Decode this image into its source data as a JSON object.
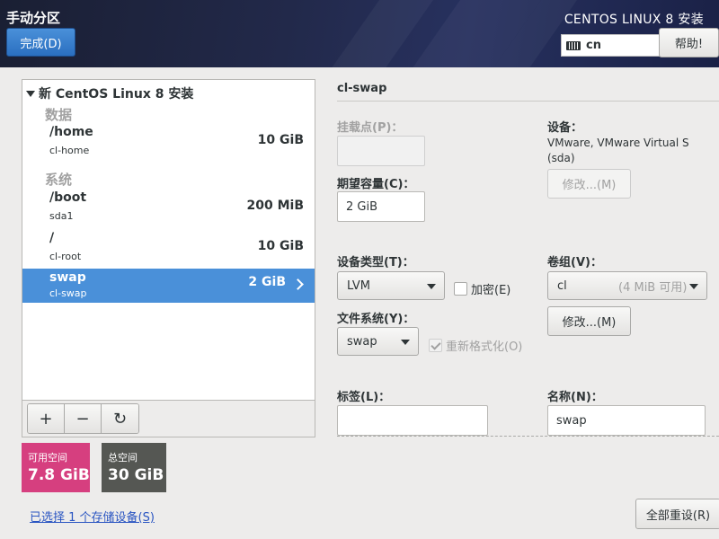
{
  "header": {
    "title": "手动分区",
    "done_label": "完成(D)",
    "product": "CENTOS LINUX 8 安装",
    "keyboard_layout": "cn",
    "help_label": "帮助!"
  },
  "tree": {
    "root_title": "新 CentOS Linux 8 安装",
    "groups": [
      {
        "label": "数据",
        "items": [
          {
            "mount": "/home",
            "device": "cl-home",
            "size": "10 GiB"
          }
        ]
      },
      {
        "label": "系统",
        "items": [
          {
            "mount": "/boot",
            "device": "sda1",
            "size": "200 MiB"
          },
          {
            "mount": "/",
            "device": "cl-root",
            "size": "10 GiB"
          },
          {
            "mount": "swap",
            "device": "cl-swap",
            "size": "2 GiB",
            "selected": true
          }
        ]
      }
    ],
    "toolbar": {
      "add": "+",
      "remove": "−",
      "refresh": "↻"
    }
  },
  "space": {
    "available_label": "可用空间",
    "available_value": "7.8 GiB",
    "total_label": "总空间",
    "total_value": "30 GiB"
  },
  "storage_link": "已选择 1 个存储设备(S)",
  "detail": {
    "title": "cl-swap",
    "mount_point_label": "挂载点(P)：",
    "mount_point_value": "",
    "desired_capacity_label": "期望容量(C)：",
    "desired_capacity_value": "2 GiB",
    "device_label": "设备：",
    "device_info": "VMware, VMware Virtual S (sda)",
    "modify_label": "修改...(M)",
    "device_type_label": "设备类型(T)：",
    "device_type_value": "LVM",
    "encrypt_label": "加密(E)",
    "volume_group_label": "卷组(V)：",
    "volume_group_value": "cl",
    "volume_group_free": "(4 MiB 可用)",
    "modify2_label": "修改...(M)",
    "filesystem_label": "文件系统(Y)：",
    "filesystem_value": "swap",
    "reformat_label": "重新格式化(O)",
    "label_label": "标签(L)：",
    "label_value": "",
    "name_label": "名称(N)：",
    "name_value": "swap",
    "reset_all_label": "全部重设(R)"
  },
  "colors": {
    "selected_row": "#4a90d9",
    "available_space": "#d63f7f",
    "total_space": "#555753",
    "done_button": "#3a7fcf"
  }
}
